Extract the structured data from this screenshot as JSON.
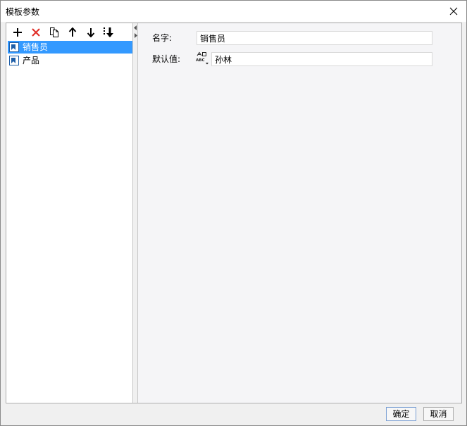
{
  "window": {
    "title": "模板参数"
  },
  "toolbar": {
    "buttons": [
      {
        "name": "add-button",
        "icon": "plus-icon"
      },
      {
        "name": "delete-button",
        "icon": "red-x-icon"
      },
      {
        "name": "copy-button",
        "icon": "copy-icon"
      },
      {
        "name": "move-up-button",
        "icon": "arrow-up-icon"
      },
      {
        "name": "move-down-button",
        "icon": "arrow-down-icon"
      },
      {
        "name": "sort-button",
        "icon": "sort-down-icon"
      }
    ]
  },
  "tree": {
    "items": [
      {
        "label": "销售员",
        "selected": true
      },
      {
        "label": "产品",
        "selected": false
      }
    ]
  },
  "form": {
    "name_label": "名字:",
    "name_value": "销售员",
    "default_label": "默认值:",
    "default_value": "孙林",
    "default_type_icon": "string-type-icon"
  },
  "footer": {
    "ok_label": "确定",
    "cancel_label": "取消"
  },
  "colors": {
    "selection": "#3399ff",
    "delete_red": "#e0302a",
    "param_icon_blue": "#1f5fa8"
  }
}
